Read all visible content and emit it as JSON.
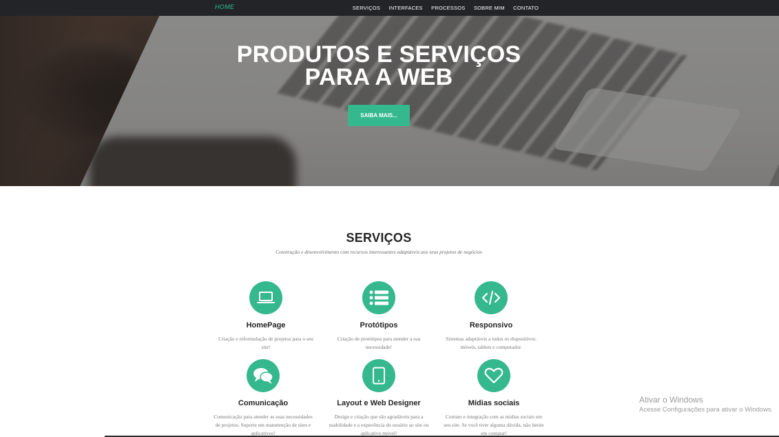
{
  "navbar": {
    "brand": "HOME",
    "links": [
      "SERVIÇOS",
      "INTERFACES",
      "PROCESSOS",
      "SOBRE MIM",
      "CONTATO"
    ]
  },
  "hero": {
    "title_line1": "PRODUTOS E SERVIÇOS",
    "title_line2": "PARA A WEB",
    "button": "SAIBA MAIS..."
  },
  "services": {
    "title": "SERVIÇOS",
    "subtitle": "Construção e desenvolvimento com recursos interessantes adaptáveis aos seus projetos de negócios",
    "items": [
      {
        "icon": "laptop-icon",
        "title": "HomePage",
        "desc": "Criação e reformulação de projetos para o seu site!"
      },
      {
        "icon": "list-icon",
        "title": "Protótipos",
        "desc": "Criação de protótipos para atender a sua necessidade!"
      },
      {
        "icon": "code-icon",
        "title": "Responsivo",
        "desc": "Sistemas adaptáveis a todos os dispositivos: móveis, tablets e computador."
      },
      {
        "icon": "chat-bubbles-icon",
        "title": "Comunicação",
        "desc": "Comunicação para atender as suas necessidades de projetos. Suporte em manutenção de sites e aplicativos!"
      },
      {
        "icon": "tablet-icon",
        "title": "Layout e Web Designer",
        "desc": "Design e criação que são agradáveis para a usabilidade e a experiência do usuário ao site ou aplicativo móvel!"
      },
      {
        "icon": "heart-icon",
        "title": "Mídias sociais",
        "desc": "Contato e integração com as mídias sociais em seu site. Se você tiver alguma dúvida, não hesite em contatar!"
      }
    ]
  },
  "windows_watermark": {
    "title": "Ativar o Windows",
    "subtitle": "Acesse Configurações para ativar o Windows."
  },
  "colors": {
    "accent": "#35b88d",
    "navbar_bg": "#222427",
    "brand": "#2fc08f"
  }
}
